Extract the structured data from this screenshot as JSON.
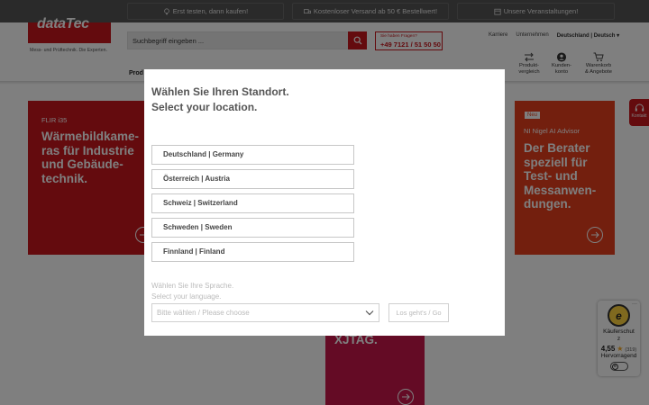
{
  "promos": [
    {
      "icon": "bulb-icon",
      "label": "Erst testen, dann kaufen!"
    },
    {
      "icon": "truck-icon",
      "label": "Kostenloser Versand ab 50 € Bestellwert!"
    },
    {
      "icon": "calendar-icon",
      "label": "Unsere Veranstaltungen!"
    }
  ],
  "header": {
    "logo": "dataTec",
    "tagline": "Mess- und Prüftechnik. Die Experten.",
    "search_placeholder": "Suchbegriff eingeben ...",
    "hotline_question": "Sie haben Fragen?",
    "hotline_number": "+49 7121 / 51 50 50",
    "links": [
      "Karriere",
      "Unternehmen"
    ],
    "language": "Deutschland | Deutsch",
    "icon_links": [
      {
        "icon": "compare-icon",
        "label": "Produkt-\nvergleich"
      },
      {
        "icon": "account-icon",
        "label": "Kunden-\nkonto"
      },
      {
        "icon": "cart-icon",
        "label": "Warenkorb\n& Angebote"
      }
    ],
    "nav_partial": "Prod"
  },
  "tiles": {
    "left": {
      "kicker": "FLIR i35",
      "headline": "Wärmebildkame-\nras für Industrie\nund Gebäude-\ntechnik."
    },
    "right": {
      "badge": "Neu",
      "kicker": "NI Nigel AI Advisor",
      "headline": "Der Berater\nspeziell für\nTest- und\nMessanwen-\ndungen."
    },
    "bottom": {
      "headline": "XJTAG."
    }
  },
  "kontakt_label": "Kontakt",
  "trusted_shops": {
    "label": "Käuferschut\nz",
    "score": "4,55",
    "count": "(319)",
    "grade": "Hervorragend"
  },
  "modal": {
    "title_de": "Wählen Sie Ihren Standort.",
    "title_en": "Select your location.",
    "locations": [
      "Deutschland | Germany",
      "Österreich | Austria",
      "Schweiz | Switzerland",
      "Schweden | Sweden",
      "Finnland | Finland"
    ],
    "language_title_de": "Wählen Sie Ihre Sprache.",
    "language_title_en": "Select your language.",
    "language_placeholder": "Bitte wählen / Please choose",
    "go_label": "Los geht's / Go"
  },
  "colors": {
    "brand": "#c8161d",
    "orange": "#e63e1c",
    "magenta": "#c8164a"
  }
}
